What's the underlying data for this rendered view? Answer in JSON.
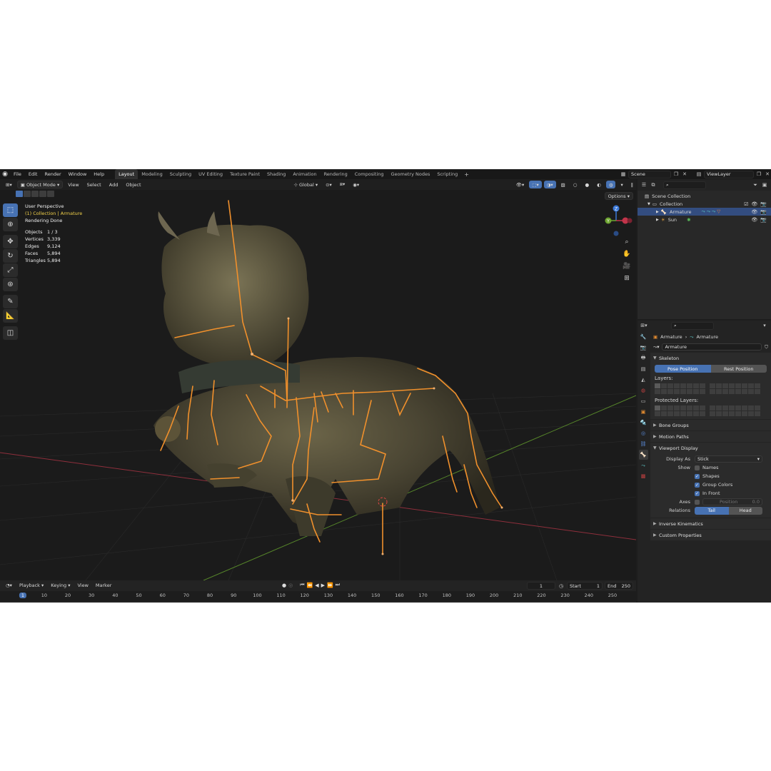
{
  "menu": [
    "File",
    "Edit",
    "Render",
    "Window",
    "Help"
  ],
  "workspaces": [
    "Layout",
    "Modeling",
    "Sculpting",
    "UV Editing",
    "Texture Paint",
    "Shading",
    "Animation",
    "Rendering",
    "Compositing",
    "Geometry Nodes",
    "Scripting"
  ],
  "scene_name": "Scene",
  "view_layer": "ViewLayer",
  "viewport_header": {
    "mode": "Object Mode",
    "menus": [
      "View",
      "Select",
      "Add",
      "Object"
    ],
    "orientation": "Global",
    "options_label": "Options"
  },
  "overlay": {
    "view_name": "User Perspective",
    "collection_line": "(1) Collection | Armature",
    "status": "Rendering Done",
    "stats": [
      {
        "label": "Objects",
        "value": "1 / 3"
      },
      {
        "label": "Vertices",
        "value": "3,339"
      },
      {
        "label": "Edges",
        "value": "9,124"
      },
      {
        "label": "Faces",
        "value": "5,894"
      },
      {
        "label": "Triangles",
        "value": "5,894"
      }
    ]
  },
  "gizmo": {
    "z": "Z",
    "y": "Y"
  },
  "timeline": {
    "menus": [
      "Playback",
      "Keying",
      "View",
      "Marker"
    ],
    "current_frame": "1",
    "start_label": "Start",
    "start": "1",
    "end_label": "End",
    "end": "250",
    "ticks": [
      "1",
      "10",
      "20",
      "30",
      "40",
      "50",
      "60",
      "70",
      "80",
      "90",
      "100",
      "110",
      "120",
      "130",
      "140",
      "150",
      "160",
      "170",
      "180",
      "190",
      "200",
      "210",
      "220",
      "230",
      "240",
      "250"
    ]
  },
  "outliner": {
    "scene_collection": "Scene Collection",
    "collection": "Collection",
    "armature": "Armature",
    "sun": "Sun"
  },
  "properties": {
    "breadcrumb_object": "Armature",
    "breadcrumb_data": "Armature",
    "data_name": "Armature",
    "skeleton_title": "Skeleton",
    "pose_position": "Pose Position",
    "rest_position": "Rest Position",
    "layers_label": "Layers:",
    "protected_layers_label": "Protected Layers:",
    "bone_groups": "Bone Groups",
    "motion_paths": "Motion Paths",
    "viewport_display": "Viewport Display",
    "display_as_label": "Display As",
    "display_as_value": "Stick",
    "show_label": "Show",
    "names": "Names",
    "shapes": "Shapes",
    "group_colors": "Group Colors",
    "in_front": "In Front",
    "axes_label": "Axes",
    "axes_position": "Position",
    "axes_value": "0.0",
    "relations_label": "Relations",
    "tail": "Tail",
    "head": "Head",
    "inverse_kinematics": "Inverse Kinematics",
    "custom_properties": "Custom Properties"
  },
  "colors": {
    "accent": "#4772b3",
    "bone": "#f0902c",
    "x_axis": "#c2344a",
    "y_axis": "#6ea531",
    "z_axis": "#3b78d8"
  }
}
